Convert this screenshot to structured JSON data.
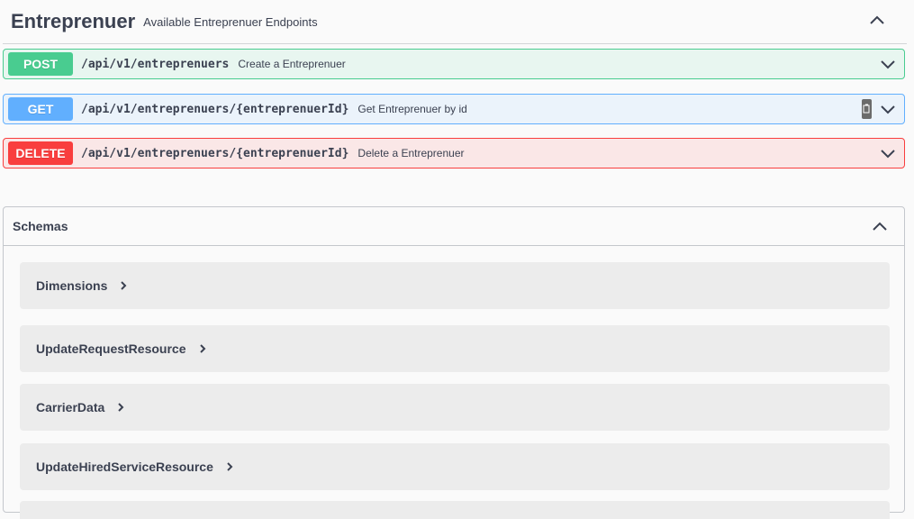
{
  "tag": {
    "title": "Entreprenuer",
    "description": "Available Entreprenuer Endpoints",
    "toggle_icon": "chevron-up-icon"
  },
  "operations": [
    {
      "method": "POST",
      "path": "/api/v1/entreprenuers",
      "summary": "Create a Entreprenuer",
      "color": "#49cc90"
    },
    {
      "method": "GET",
      "path": "/api/v1/entreprenuers/{entreprenuerId}",
      "summary": "Get Entreprenuer by id",
      "color": "#61affe"
    },
    {
      "method": "DELETE",
      "path": "/api/v1/entreprenuers/{entreprenuerId}",
      "summary": "Delete a Entreprenuer",
      "color": "#f93e3e"
    }
  ],
  "schemas": {
    "title": "Schemas",
    "models": [
      {
        "name": "Dimensions"
      },
      {
        "name": "UpdateRequestResource"
      },
      {
        "name": "CarrierData"
      },
      {
        "name": "UpdateHiredServiceResource"
      }
    ]
  }
}
